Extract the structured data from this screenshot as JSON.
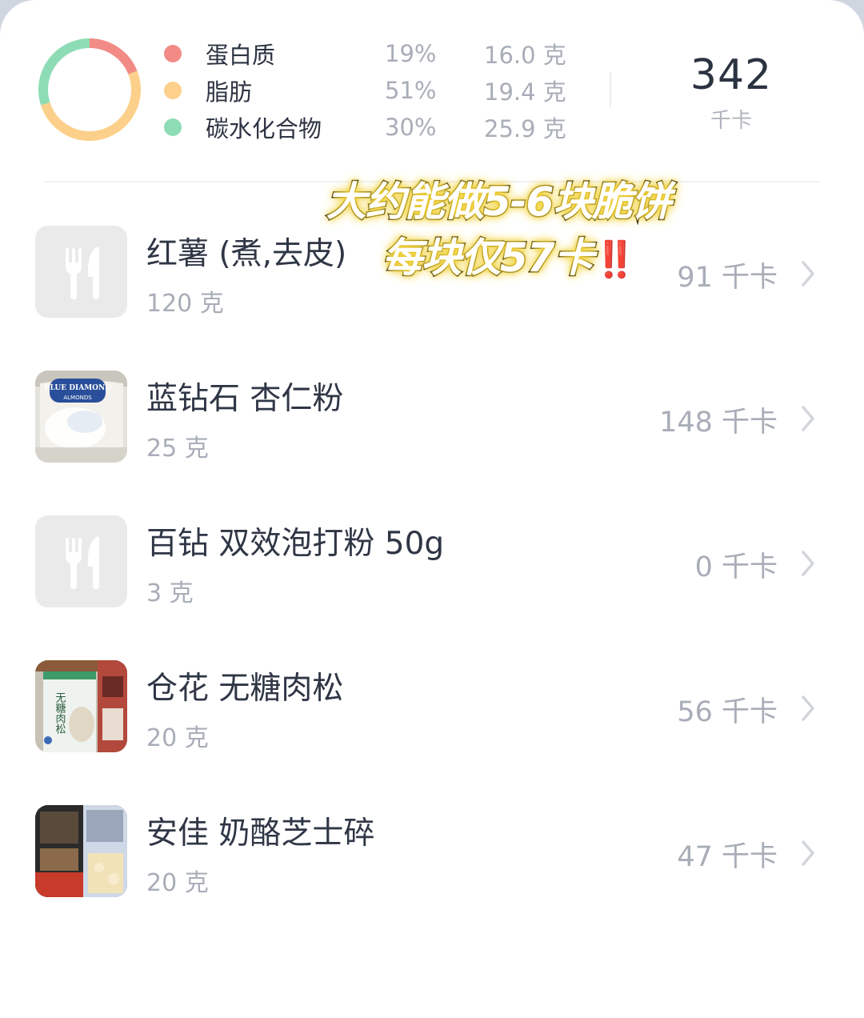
{
  "summary": {
    "macros": [
      {
        "name": "蛋白质",
        "pct": "19%",
        "grams": "16.0 克",
        "color": "#f28b86"
      },
      {
        "name": "脂肪",
        "pct": "51%",
        "grams": "19.4 克",
        "color": "#fcd08a"
      },
      {
        "name": "碳水化合物",
        "pct": "30%",
        "grams": "25.9 克",
        "color": "#8edcb5"
      }
    ],
    "total_kcal": "342",
    "kcal_unit": "千卡"
  },
  "overlay": {
    "line1": "大约能做5-6块脆饼",
    "line2": "每块仅57卡",
    "emoji": "‼️"
  },
  "foods": [
    {
      "name": "红薯 (煮,去皮)",
      "weight": "120 克",
      "kcal": "91 千卡",
      "thumb": "fork-knife-icon"
    },
    {
      "name": "蓝钻石 杏仁粉",
      "weight": "25 克",
      "kcal": "148 千卡",
      "thumb": "almond-flour-photo"
    },
    {
      "name": "百钻 双效泡打粉 50g",
      "weight": "3 克",
      "kcal": "0 千卡",
      "thumb": "fork-knife-icon"
    },
    {
      "name": "仓花 无糖肉松",
      "weight": "20 克",
      "kcal": "56 千卡",
      "thumb": "meat-floss-photo"
    },
    {
      "name": "安佳 奶酪芝士碎",
      "weight": "20 克",
      "kcal": "47 千卡",
      "thumb": "cheese-photo"
    }
  ],
  "photo_text": {
    "almond_brand": "BLUE DIAMOND",
    "almond_sub": "ALMONDS",
    "floss_label": "无糖肉松"
  },
  "colors": {
    "protein": "#f28b86",
    "fat": "#fcd08a",
    "carbs": "#8edcb5",
    "text_primary": "#2f3645",
    "text_secondary": "#a8adb8"
  }
}
